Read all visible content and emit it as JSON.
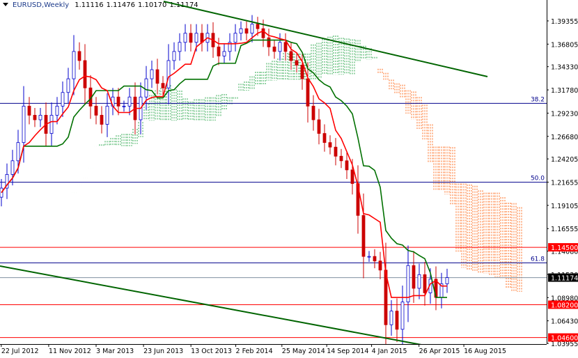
{
  "header": {
    "symbol_timeframe": "EURUSD,Weekly",
    "open": "1.11116",
    "high": "1.11476",
    "low": "1.10170",
    "close": "1.11174"
  },
  "colors": {
    "bull_candle": "#0000cc",
    "bear_candle": "#cc0000",
    "tenkan": "#ff0000",
    "kijun": "#007000",
    "cloud_up": "#2fa84f",
    "cloud_down": "#ff6a1a",
    "trendline": "#006400",
    "fib": "#00008b",
    "level": "#ff0000",
    "current": "#8090a0"
  },
  "chart_data": {
    "type": "candlestick",
    "title": "EURUSD,Weekly",
    "ylim": [
      1.03955,
      1.39355
    ],
    "y_ticks": [
      "1.39355",
      "1.36805",
      "1.34330",
      "1.31780",
      "1.29230",
      "1.26680",
      "1.24205",
      "1.21655",
      "1.19105",
      "1.16555",
      "1.14080",
      "1.11530",
      "1.08980",
      "1.06430",
      "1.03955"
    ],
    "x_ticks": [
      "22 Jul 2012",
      "11 Nov 2012",
      "3 Mar 2013",
      "23 Jun 2013",
      "13 Oct 2013",
      "2 Feb 2014",
      "25 May 2014",
      "14 Sep 2014",
      "4 Jan 2015",
      "26 Apr 2015",
      "16 Aug 2015"
    ],
    "closes": [
      1.21,
      1.225,
      1.24,
      1.26,
      1.3,
      1.29,
      1.285,
      1.29,
      1.27,
      1.29,
      1.3,
      1.315,
      1.33,
      1.36,
      1.35,
      1.32,
      1.3,
      1.29,
      1.28,
      1.3,
      1.31,
      1.3,
      1.3,
      1.31,
      1.285,
      1.31,
      1.33,
      1.34,
      1.325,
      1.32,
      1.35,
      1.36,
      1.37,
      1.38,
      1.37,
      1.38,
      1.37,
      1.38,
      1.365,
      1.355,
      1.36,
      1.37,
      1.38,
      1.385,
      1.38,
      1.39,
      1.385,
      1.375,
      1.365,
      1.36,
      1.37,
      1.36,
      1.35,
      1.345,
      1.33,
      1.3,
      1.285,
      1.27,
      1.26,
      1.255,
      1.245,
      1.24,
      1.23,
      1.215,
      1.18,
      1.135,
      1.135,
      1.13,
      1.12,
      1.06,
      1.075,
      1.055,
      1.085,
      1.125,
      1.1,
      1.115,
      1.095,
      1.11,
      1.09,
      1.105,
      1.11174
    ],
    "fib_levels": [
      {
        "label": "38.2",
        "price": 1.303
      },
      {
        "label": "50.0",
        "price": 1.2165
      },
      {
        "label": "61.8",
        "price": 1.128
      }
    ],
    "support_resistance": [
      {
        "label": "1.14500",
        "price": 1.145
      },
      {
        "label": "1.08200",
        "price": 1.082
      },
      {
        "label": "1.04600",
        "price": 1.046
      }
    ],
    "current_price": {
      "label": "1.11174",
      "price": 1.11174
    },
    "trendlines": [
      {
        "name": "upper",
        "points": [
          [
            "2013-12",
            1.416
          ],
          [
            "2016-03",
            1.333
          ]
        ]
      },
      {
        "name": "lower",
        "points": [
          [
            "2012-07",
            1.13
          ],
          [
            "2015-05",
            1.044
          ]
        ]
      }
    ],
    "indicators": [
      "Ichimoku Tenkan-sen",
      "Ichimoku Kijun-sen",
      "Ichimoku Kumo cloud"
    ]
  }
}
